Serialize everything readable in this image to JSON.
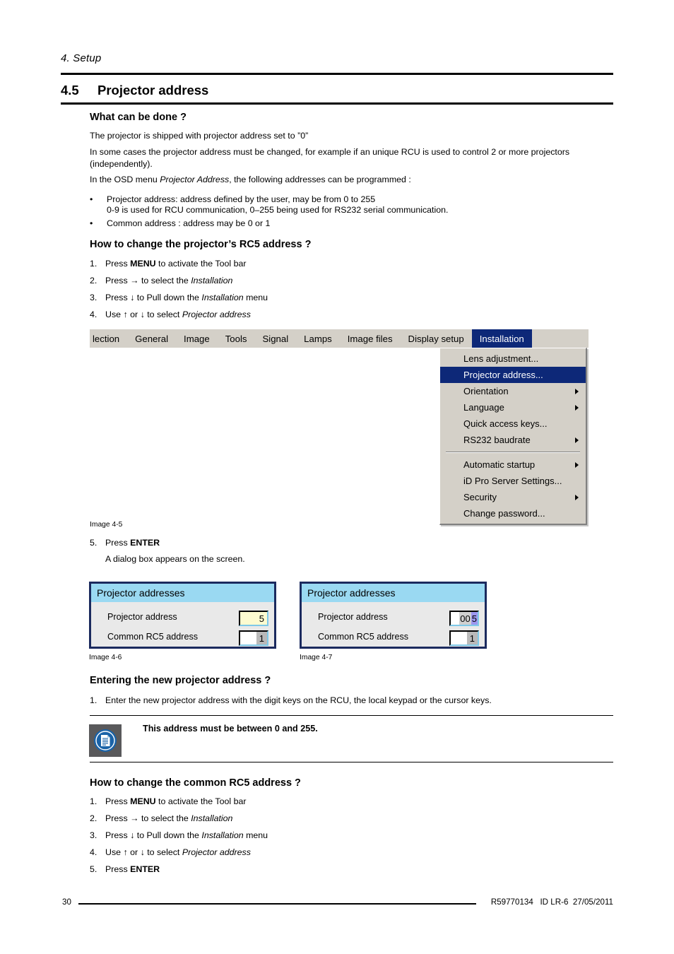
{
  "header": {
    "running_head": "4.  Setup",
    "section_number": "4.5",
    "section_title": "Projector address"
  },
  "what_can_be_done": {
    "heading": "What can be done ?",
    "p1": "The projector is shipped with projector address set to ”0”",
    "p2": "In some cases the projector address must be changed, for example if an unique RCU is used to control 2 or more projectors (independently).",
    "p3_before": "In the OSD menu ",
    "p3_italic": "Projector Address",
    "p3_after": ", the following addresses can be programmed :",
    "bullets": [
      {
        "line1": "Projector address:  address defined by the user, may be from 0 to 255",
        "line2": "0-9 is used for RCU communication, 0–255 being used for RS232 serial communication."
      },
      {
        "line1": "Common address :  address may be 0 or 1",
        "line2": ""
      }
    ]
  },
  "how_to_change_rc5": {
    "heading": "How to change the projector’s RC5 address ?",
    "steps": [
      {
        "num": "1.",
        "before": "Press ",
        "bold": "MENU",
        "after": " to activate the Tool bar",
        "italic": "",
        "tail": ""
      },
      {
        "num": "2.",
        "before": "Press → to select the ",
        "bold": "",
        "after": "",
        "italic": "Installation",
        "tail": ""
      },
      {
        "num": "3.",
        "before": "Press ↓ to Pull down the ",
        "bold": "",
        "after": "",
        "italic": "Installation",
        "tail": " menu"
      },
      {
        "num": "4.",
        "before": "Use ↑ or ↓ to select ",
        "bold": "",
        "after": "",
        "italic": "Projector address",
        "tail": ""
      }
    ],
    "step5_num": "5.",
    "step5_before": "Press ",
    "step5_bold": "ENTER",
    "step5_note": "A dialog box appears on the screen."
  },
  "osd": {
    "caption": "Image 4-5",
    "menubar": [
      {
        "label": "lection",
        "active": false
      },
      {
        "label": "General",
        "active": false
      },
      {
        "label": "Image",
        "active": false
      },
      {
        "label": "Tools",
        "active": false
      },
      {
        "label": "Signal",
        "active": false
      },
      {
        "label": "Lamps",
        "active": false
      },
      {
        "label": "Image files",
        "active": false
      },
      {
        "label": "Display setup",
        "active": false
      },
      {
        "label": "Installation",
        "active": true
      }
    ],
    "dropdown_group1": [
      {
        "label": "Lens adjustment...",
        "selected": false,
        "submenu": false
      },
      {
        "label": "Projector address...",
        "selected": true,
        "submenu": false
      },
      {
        "label": "Orientation",
        "selected": false,
        "submenu": true
      },
      {
        "label": "Language",
        "selected": false,
        "submenu": true
      },
      {
        "label": "Quick access keys...",
        "selected": false,
        "submenu": false
      },
      {
        "label": "RS232 baudrate",
        "selected": false,
        "submenu": true
      }
    ],
    "dropdown_group2": [
      {
        "label": "Automatic startup",
        "selected": false,
        "submenu": true
      },
      {
        "label": "iD Pro Server Settings...",
        "selected": false,
        "submenu": false
      },
      {
        "label": "Security",
        "selected": false,
        "submenu": true
      },
      {
        "label": "Change password...",
        "selected": false,
        "submenu": false
      }
    ],
    "colors": {
      "menubar_bg": "#d4d0c8",
      "selected_bg": "#0d2878",
      "selected_fg": "#ffffff"
    }
  },
  "dialogs": [
    {
      "caption": "Image 4-6",
      "title": "Projector addresses",
      "row1_label": "Projector address",
      "row1_value": "5",
      "row2_label": "Common RC5 address",
      "row2_value": "1"
    },
    {
      "caption": "Image 4-7",
      "title": "Projector addresses",
      "row1_label": "Projector address",
      "row1_value_dim": "00",
      "row1_value_hl": "5",
      "row2_label": "Common RC5 address",
      "row2_value": "1"
    }
  ],
  "entering_new_address": {
    "heading": "Entering the new projector address ?",
    "step1_num": "1.",
    "step1_text": "Enter the new projector address with the digit keys on the RCU, the local keypad or the cursor keys."
  },
  "note": {
    "icon": "note-document-icon",
    "text": "This address must be between 0 and 255."
  },
  "how_to_change_common": {
    "heading": "How to change the common RC5 address ?",
    "steps": [
      {
        "num": "1.",
        "before": "Press ",
        "bold": "MENU",
        "after": " to activate the Tool bar",
        "italic": "",
        "tail": ""
      },
      {
        "num": "2.",
        "before": "Press → to select the ",
        "bold": "",
        "after": "",
        "italic": "Installation",
        "tail": ""
      },
      {
        "num": "3.",
        "before": "Press ↓ to Pull down the ",
        "bold": "",
        "after": "",
        "italic": "Installation",
        "tail": " menu"
      },
      {
        "num": "4.",
        "before": "Use ↑ or ↓ to select ",
        "bold": "",
        "after": "",
        "italic": "Projector address",
        "tail": ""
      },
      {
        "num": "5.",
        "before": "Press ",
        "bold": "ENTER",
        "after": "",
        "italic": "",
        "tail": ""
      }
    ]
  },
  "footer": {
    "page_number": "30",
    "doc_id": "R59770134   ID LR-6  27/05/2011"
  }
}
